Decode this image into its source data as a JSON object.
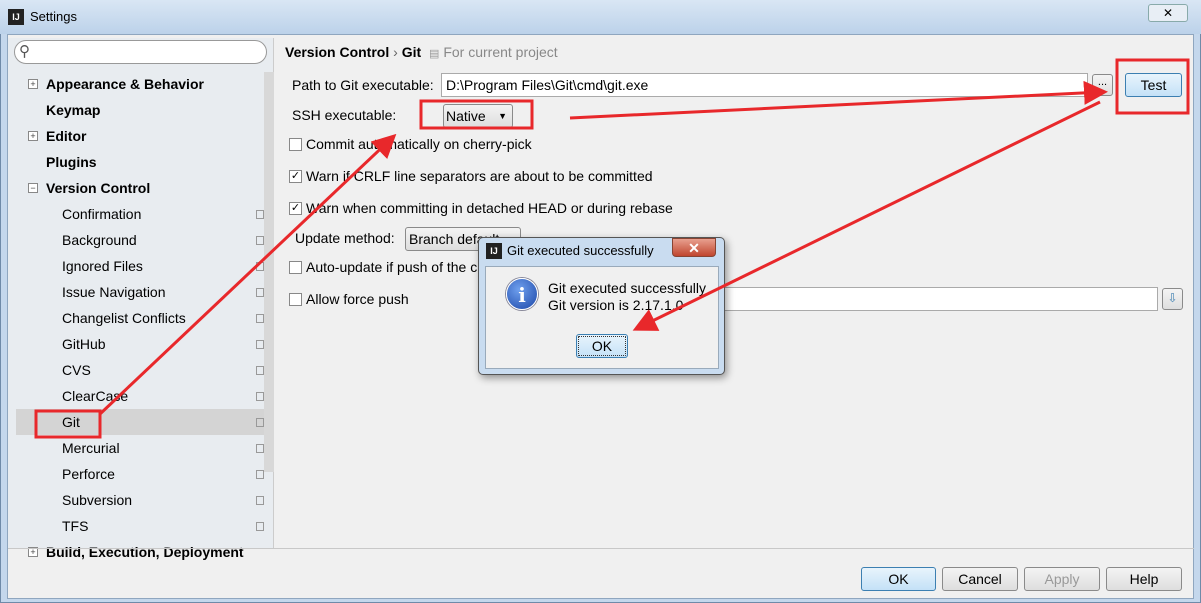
{
  "window": {
    "title": "Settings",
    "close": "✕"
  },
  "search": {
    "placeholder": ""
  },
  "sidebar": {
    "items": [
      {
        "label": "Appearance & Behavior",
        "top": true,
        "expander": "+"
      },
      {
        "label": "Keymap",
        "top": true
      },
      {
        "label": "Editor",
        "top": true,
        "expander": "+"
      },
      {
        "label": "Plugins",
        "top": true
      },
      {
        "label": "Version Control",
        "top": true,
        "expander": "−"
      },
      {
        "label": "Confirmation"
      },
      {
        "label": "Background"
      },
      {
        "label": "Ignored Files"
      },
      {
        "label": "Issue Navigation"
      },
      {
        "label": "Changelist Conflicts"
      },
      {
        "label": "GitHub"
      },
      {
        "label": "CVS"
      },
      {
        "label": "ClearCase"
      },
      {
        "label": "Git",
        "selected": true
      },
      {
        "label": "Mercurial"
      },
      {
        "label": "Perforce"
      },
      {
        "label": "Subversion"
      },
      {
        "label": "TFS"
      },
      {
        "label": "Build, Execution, Deployment",
        "top": true,
        "expander": "+"
      }
    ]
  },
  "breadcrumb": {
    "parent": "Version Control",
    "sep": "›",
    "current": "Git",
    "scope": "For current project"
  },
  "git": {
    "path_label": "Path to Git executable:",
    "path_value": "D:\\Program Files\\Git\\cmd\\git.exe",
    "browse": "...",
    "test": "Test",
    "ssh_label": "SSH executable:",
    "ssh_value": "Native",
    "cherry_pick": "Commit automatically on cherry-pick",
    "crlf": "Warn if CRLF line separators are about to be committed",
    "detached": "Warn when committing in detached HEAD or during rebase",
    "update_label": "Update method:",
    "update_value": "Branch default",
    "auto_update": "Auto-update if push of the current branch was rejected",
    "force_push": "Allow force push"
  },
  "dialog": {
    "title": "Git executed successfully",
    "line1": "Git executed successfully",
    "line2": "Git version is 2.17.1.0",
    "ok": "OK",
    "close": "✕",
    "icon": "info-icon"
  },
  "buttons": {
    "ok": "OK",
    "cancel": "Cancel",
    "apply": "Apply",
    "help": "Help"
  },
  "colors": {
    "annotation": "#e8282b",
    "accent": "#3c7fb1"
  }
}
